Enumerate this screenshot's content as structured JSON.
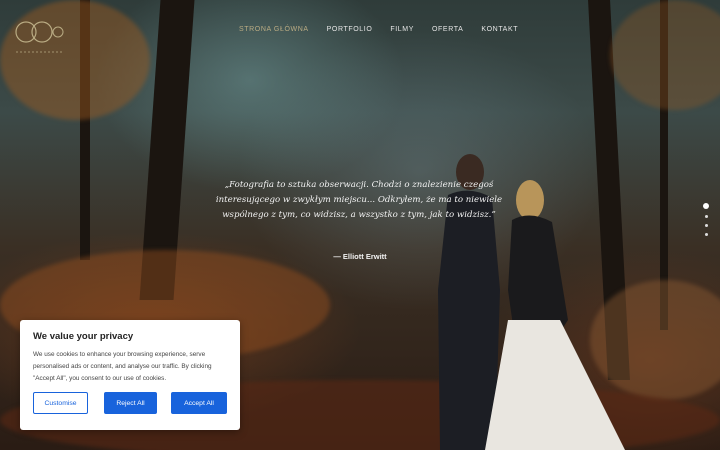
{
  "nav": {
    "items": [
      {
        "label": "STRONA GŁÓWNA",
        "active": true
      },
      {
        "label": "PORTFOLIO",
        "active": false
      },
      {
        "label": "FILMY",
        "active": false
      },
      {
        "label": "OFERTA",
        "active": false
      },
      {
        "label": "KONTAKT",
        "active": false
      }
    ]
  },
  "hero": {
    "quote": "„Fotografia to sztuka obserwacji. Chodzi o znalezienie czegoś interesującego w zwykłym miejscu... Odkryłem, że ma to niewiele wspólnego z tym, co widzisz, a wszystko z tym, jak to widzisz.”",
    "author": "— Elliott Erwitt"
  },
  "slider": {
    "count": 4,
    "active_index": 0
  },
  "cookie_banner": {
    "title": "We value your privacy",
    "text": "We use cookies to enhance your browsing experience, serve personalised ads or content, and analyse our traffic. By clicking \"Accept All\", you consent to our use of cookies.",
    "customise_label": "Customise",
    "reject_label": "Reject All",
    "accept_label": "Accept All",
    "accent_color": "#1863dc"
  },
  "colors": {
    "nav_active": "#b9ab83",
    "nav_text": "#e6e6e6"
  }
}
